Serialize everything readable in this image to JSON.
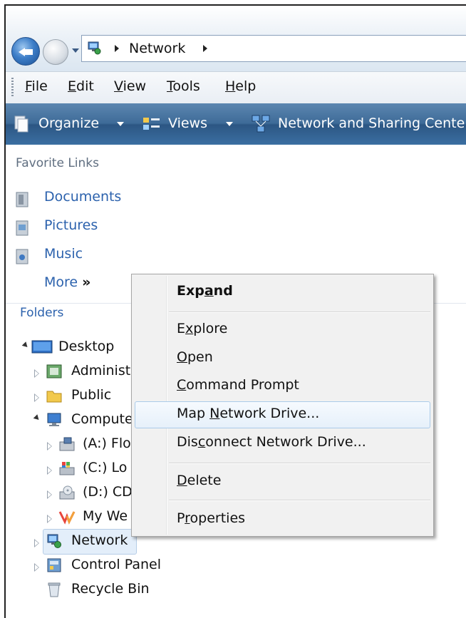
{
  "address_bar": {
    "breadcrumb": "Network"
  },
  "menu_bar": {
    "items": [
      {
        "label": "File",
        "accel": "F",
        "rest": "ile"
      },
      {
        "label": "Edit",
        "accel": "E",
        "rest": "dit"
      },
      {
        "label": "View",
        "accel": "V",
        "rest": "iew"
      },
      {
        "label": "Tools",
        "accel": "T",
        "rest": "ools"
      },
      {
        "label": "Help",
        "accel": "H",
        "rest": "elp"
      }
    ]
  },
  "command_bar": {
    "organize": "Organize",
    "views": "Views",
    "network_sharing": "Network and Sharing Cente"
  },
  "favorite_links": {
    "title": "Favorite Links",
    "items": [
      "Documents",
      "Pictures",
      "Music"
    ],
    "more": "More",
    "more_glyph": "»"
  },
  "folders": {
    "title": "Folders",
    "desktop": "Desktop",
    "administrator": "Administ",
    "public": "Public",
    "computer": "Compute",
    "floppy": "(A:) Flo",
    "local_disk": "(C:) Lo",
    "cd_drive": "(D:) CD",
    "my_web": "My We",
    "network": "Network",
    "control_panel": "Control Panel",
    "recycle_bin": "Recycle Bin"
  },
  "context_menu": {
    "expand": {
      "pre": "Exp",
      "accel": "a",
      "post": "nd"
    },
    "explore": {
      "pre": "E",
      "accel": "x",
      "post": "plore"
    },
    "open": {
      "pre": "",
      "accel": "O",
      "post": "pen"
    },
    "command_prompt": {
      "pre": "",
      "accel": "C",
      "post": "ommand Prompt"
    },
    "map_drive": {
      "pre": "Map ",
      "accel": "N",
      "post": "etwork Drive..."
    },
    "disconnect_drive": {
      "pre": "Dis",
      "accel": "c",
      "post": "onnect Network Drive..."
    },
    "delete": {
      "pre": "",
      "accel": "D",
      "post": "elete"
    },
    "properties": {
      "pre": "P",
      "accel": "r",
      "post": "operties"
    }
  },
  "colors": {
    "command_bar": "#3e6b98",
    "link": "#2c62ad",
    "selection": "#e3eefa"
  }
}
